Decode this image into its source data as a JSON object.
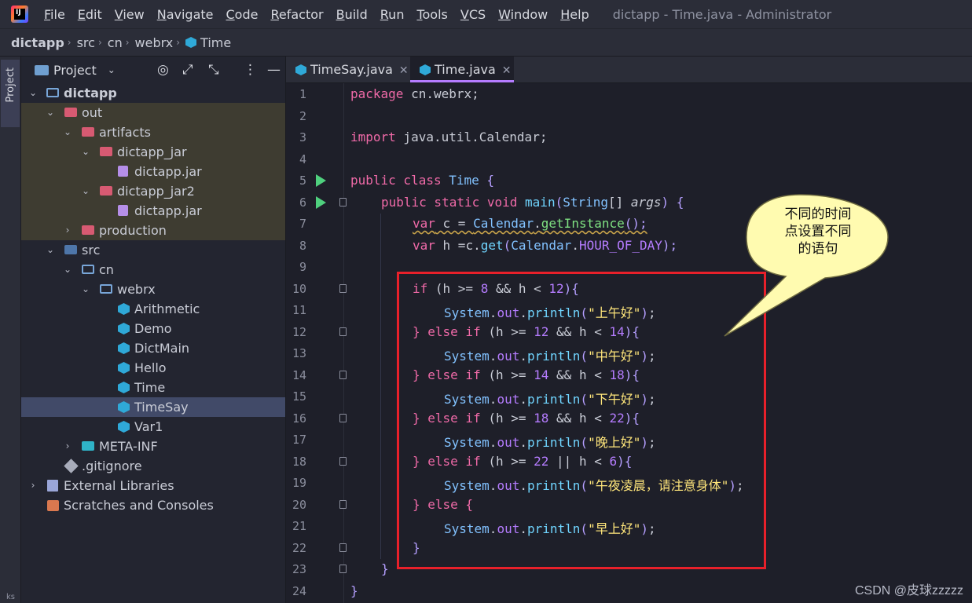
{
  "menu": {
    "items": [
      {
        "u": "F",
        "rest": "ile"
      },
      {
        "u": "E",
        "rest": "dit"
      },
      {
        "u": "V",
        "rest": "iew"
      },
      {
        "u": "N",
        "rest": "avigate"
      },
      {
        "u": "C",
        "rest": "ode"
      },
      {
        "u": "R",
        "rest": "efactor"
      },
      {
        "u": "B",
        "rest": "uild"
      },
      {
        "u": "R",
        "rest": "un"
      },
      {
        "u": "T",
        "rest": "ools"
      },
      {
        "u": "V",
        "rest": "CS"
      },
      {
        "u": "W",
        "rest": "indow"
      },
      {
        "u": "H",
        "rest": "elp"
      }
    ],
    "window_title": "dictapp - Time.java - Administrator"
  },
  "breadcrumb": [
    "dictapp",
    "src",
    "cn",
    "webrx",
    "Time"
  ],
  "tool_stripe": {
    "label": "Project",
    "bottom_text": "ks"
  },
  "project_panel": {
    "title": "Project",
    "tree": [
      {
        "label": "dictapp",
        "bold": true
      },
      {
        "label": "out"
      },
      {
        "label": "artifacts"
      },
      {
        "label": "dictapp_jar"
      },
      {
        "label": "dictapp.jar"
      },
      {
        "label": "dictapp_jar2"
      },
      {
        "label": "dictapp.jar"
      },
      {
        "label": "production"
      },
      {
        "label": "src"
      },
      {
        "label": "cn"
      },
      {
        "label": "webrx"
      },
      {
        "label": "Arithmetic"
      },
      {
        "label": "Demo"
      },
      {
        "label": "DictMain"
      },
      {
        "label": "Hello"
      },
      {
        "label": "Time"
      },
      {
        "label": "TimeSay",
        "selected": true
      },
      {
        "label": "Var1"
      },
      {
        "label": "META-INF"
      },
      {
        "label": ".gitignore"
      },
      {
        "label": "External Libraries"
      },
      {
        "label": "Scratches and Consoles"
      }
    ]
  },
  "tabs": [
    {
      "label": "TimeSay.java",
      "active": false
    },
    {
      "label": "Time.java",
      "active": true
    }
  ],
  "line_numbers": [
    "1",
    "2",
    "3",
    "4",
    "5",
    "6",
    "7",
    "8",
    "9",
    "10",
    "11",
    "12",
    "13",
    "14",
    "15",
    "16",
    "17",
    "18",
    "19",
    "20",
    "21",
    "22",
    "23",
    "24"
  ],
  "code": {
    "pkg_kw": "package",
    "pkg_name": " cn.webrx;",
    "imp_kw": "import",
    "imp_name": " java.util.Calendar;",
    "cls_kw1": "public",
    "cls_kw2": " class",
    "cls_name": " Time",
    "cls_brace": " {",
    "main_kw1": "public",
    "main_kw2": " static",
    "main_kw3": " void",
    "main_fn": " main",
    "main_p1": "(",
    "main_type": "String",
    "main_arr": "[] ",
    "main_arg": "args",
    "main_p2": ") {",
    "l7_kw": "var",
    "l7_a": " c = ",
    "l7_cls": "Calendar",
    "l7_dot": ".",
    "l7_fn": "getInstance",
    "l7_end": "();",
    "l8_kw": "var",
    "l8_a": " h =c.",
    "l8_fn": "get",
    "l8_p": "(",
    "l8_cls": "Calendar",
    "l8_dot": ".",
    "l8_const": "HOUR_OF_DAY",
    "l8_end": ");",
    "if1": "if",
    "if1_a": " (h >= ",
    "if1_n1": "8",
    "if1_b": " && h < ",
    "if1_n2": "12",
    "if1_c": "){",
    "sys": "System",
    "out": "out",
    "println": "println",
    "s1": "\"上午好\"",
    "s2": "\"中午好\"",
    "s3": "\"下午好\"",
    "s4": "\"晚上好\"",
    "s5": "\"午夜凌晨，请注意身体\"",
    "s6": "\"早上好\"",
    "elif": "} else if",
    "else_open": "} else {",
    "c2_a": " (h >= ",
    "c2_n1": "12",
    "c2_b": " && h < ",
    "c2_n2": "14",
    "c3_n1": "14",
    "c3_n2": "18",
    "c4_n1": "18",
    "c4_n2": "22",
    "c5_a": " (h >= ",
    "c5_n1": "22",
    "c5_b": " || h < ",
    "c5_n2": "6",
    "close_if": "}",
    "close_main": "}",
    "close_cls": "}"
  },
  "annotation": {
    "text_lines": [
      "不同的时间",
      "点设置不同",
      "的语句"
    ]
  },
  "watermark": "CSDN @皮球zzzzz",
  "colors": {
    "keyword": "#f06aa8",
    "type": "#82c2ff",
    "string": "#ffe67b",
    "number": "#b57cff",
    "highlight_box": "#e8202a",
    "callout_fill": "#fffbb0"
  }
}
